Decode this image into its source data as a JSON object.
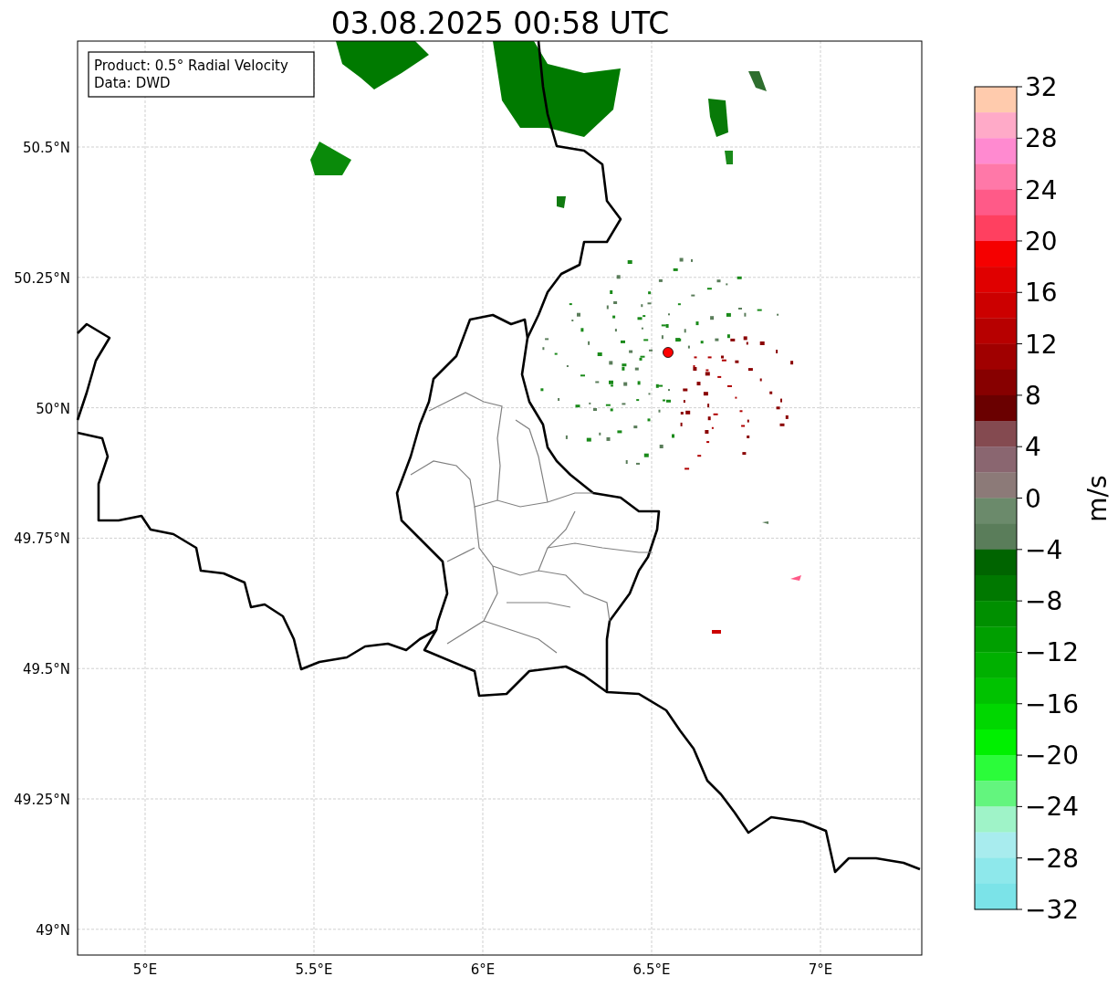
{
  "title": "03.08.2025 00:58 UTC",
  "legend": [
    "Product: 0.5° Radial Velocity",
    "Data: DWD"
  ],
  "x_axis": {
    "ticks": [
      "5°E",
      "5.5°E",
      "6°E",
      "6.5°E",
      "7°E"
    ]
  },
  "y_axis": {
    "ticks": [
      "50.5°N",
      "50.25°N",
      "50°N",
      "49.75°N",
      "49.5°N",
      "49.25°N",
      "49°N"
    ]
  },
  "colorbar": {
    "label": "m/s",
    "ticks": [
      "32",
      "28",
      "24",
      "20",
      "16",
      "12",
      "8",
      "4",
      "0",
      "−4",
      "−8",
      "−12",
      "−16",
      "−20",
      "−24",
      "−28",
      "−32"
    ],
    "segments": [
      {
        "color": "#ffcbad"
      },
      {
        "color": "#ffaac8"
      },
      {
        "color": "#ff8ad0"
      },
      {
        "color": "#ff78a8"
      },
      {
        "color": "#ff5a88"
      },
      {
        "color": "#ff4060"
      },
      {
        "color": "#f50000"
      },
      {
        "color": "#e00000"
      },
      {
        "color": "#cc0000"
      },
      {
        "color": "#b70000"
      },
      {
        "color": "#a00000"
      },
      {
        "color": "#870000"
      },
      {
        "color": "#6a0000"
      },
      {
        "color": "#844a50"
      },
      {
        "color": "#8a6670"
      },
      {
        "color": "#8c7a78"
      },
      {
        "color": "#6b8a6b"
      },
      {
        "color": "#5a7d5a"
      },
      {
        "color": "#006400"
      },
      {
        "color": "#007800"
      },
      {
        "color": "#008f00"
      },
      {
        "color": "#009f00"
      },
      {
        "color": "#00b000"
      },
      {
        "color": "#00c200"
      },
      {
        "color": "#00d700"
      },
      {
        "color": "#00f000"
      },
      {
        "color": "#2bfc3a"
      },
      {
        "color": "#63f57e"
      },
      {
        "color": "#9ff3c8"
      },
      {
        "color": "#a8ecee"
      },
      {
        "color": "#8ee8eb"
      },
      {
        "color": "#7be3e8"
      }
    ]
  }
}
